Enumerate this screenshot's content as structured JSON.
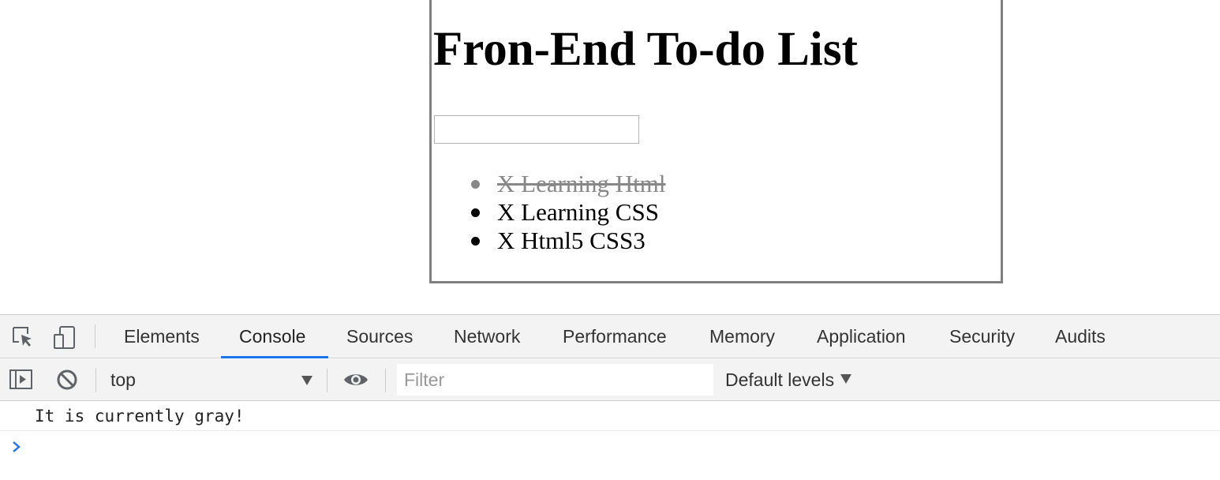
{
  "page": {
    "title": "Fron-End To-do List",
    "input_value": "",
    "todos": [
      {
        "label": "X Learning Html",
        "done": true
      },
      {
        "label": "X Learning CSS",
        "done": false
      },
      {
        "label": "X Html5 CSS3",
        "done": false
      }
    ]
  },
  "devtools": {
    "tabs": [
      {
        "label": "Elements"
      },
      {
        "label": "Console",
        "active": true
      },
      {
        "label": "Sources"
      },
      {
        "label": "Network"
      },
      {
        "label": "Performance"
      },
      {
        "label": "Memory"
      },
      {
        "label": "Application"
      },
      {
        "label": "Security"
      },
      {
        "label": "Audits"
      }
    ],
    "toolbar": {
      "context": "top",
      "filter_placeholder": "Filter",
      "filter_value": "",
      "levels_label": "Default levels"
    },
    "console": {
      "messages": [
        "It is currently gray!"
      ],
      "prompt_icon": "chevron-right-icon"
    },
    "colors": {
      "accent": "#1a73e8",
      "done_text": "#888888",
      "box_border": "#808080"
    }
  }
}
